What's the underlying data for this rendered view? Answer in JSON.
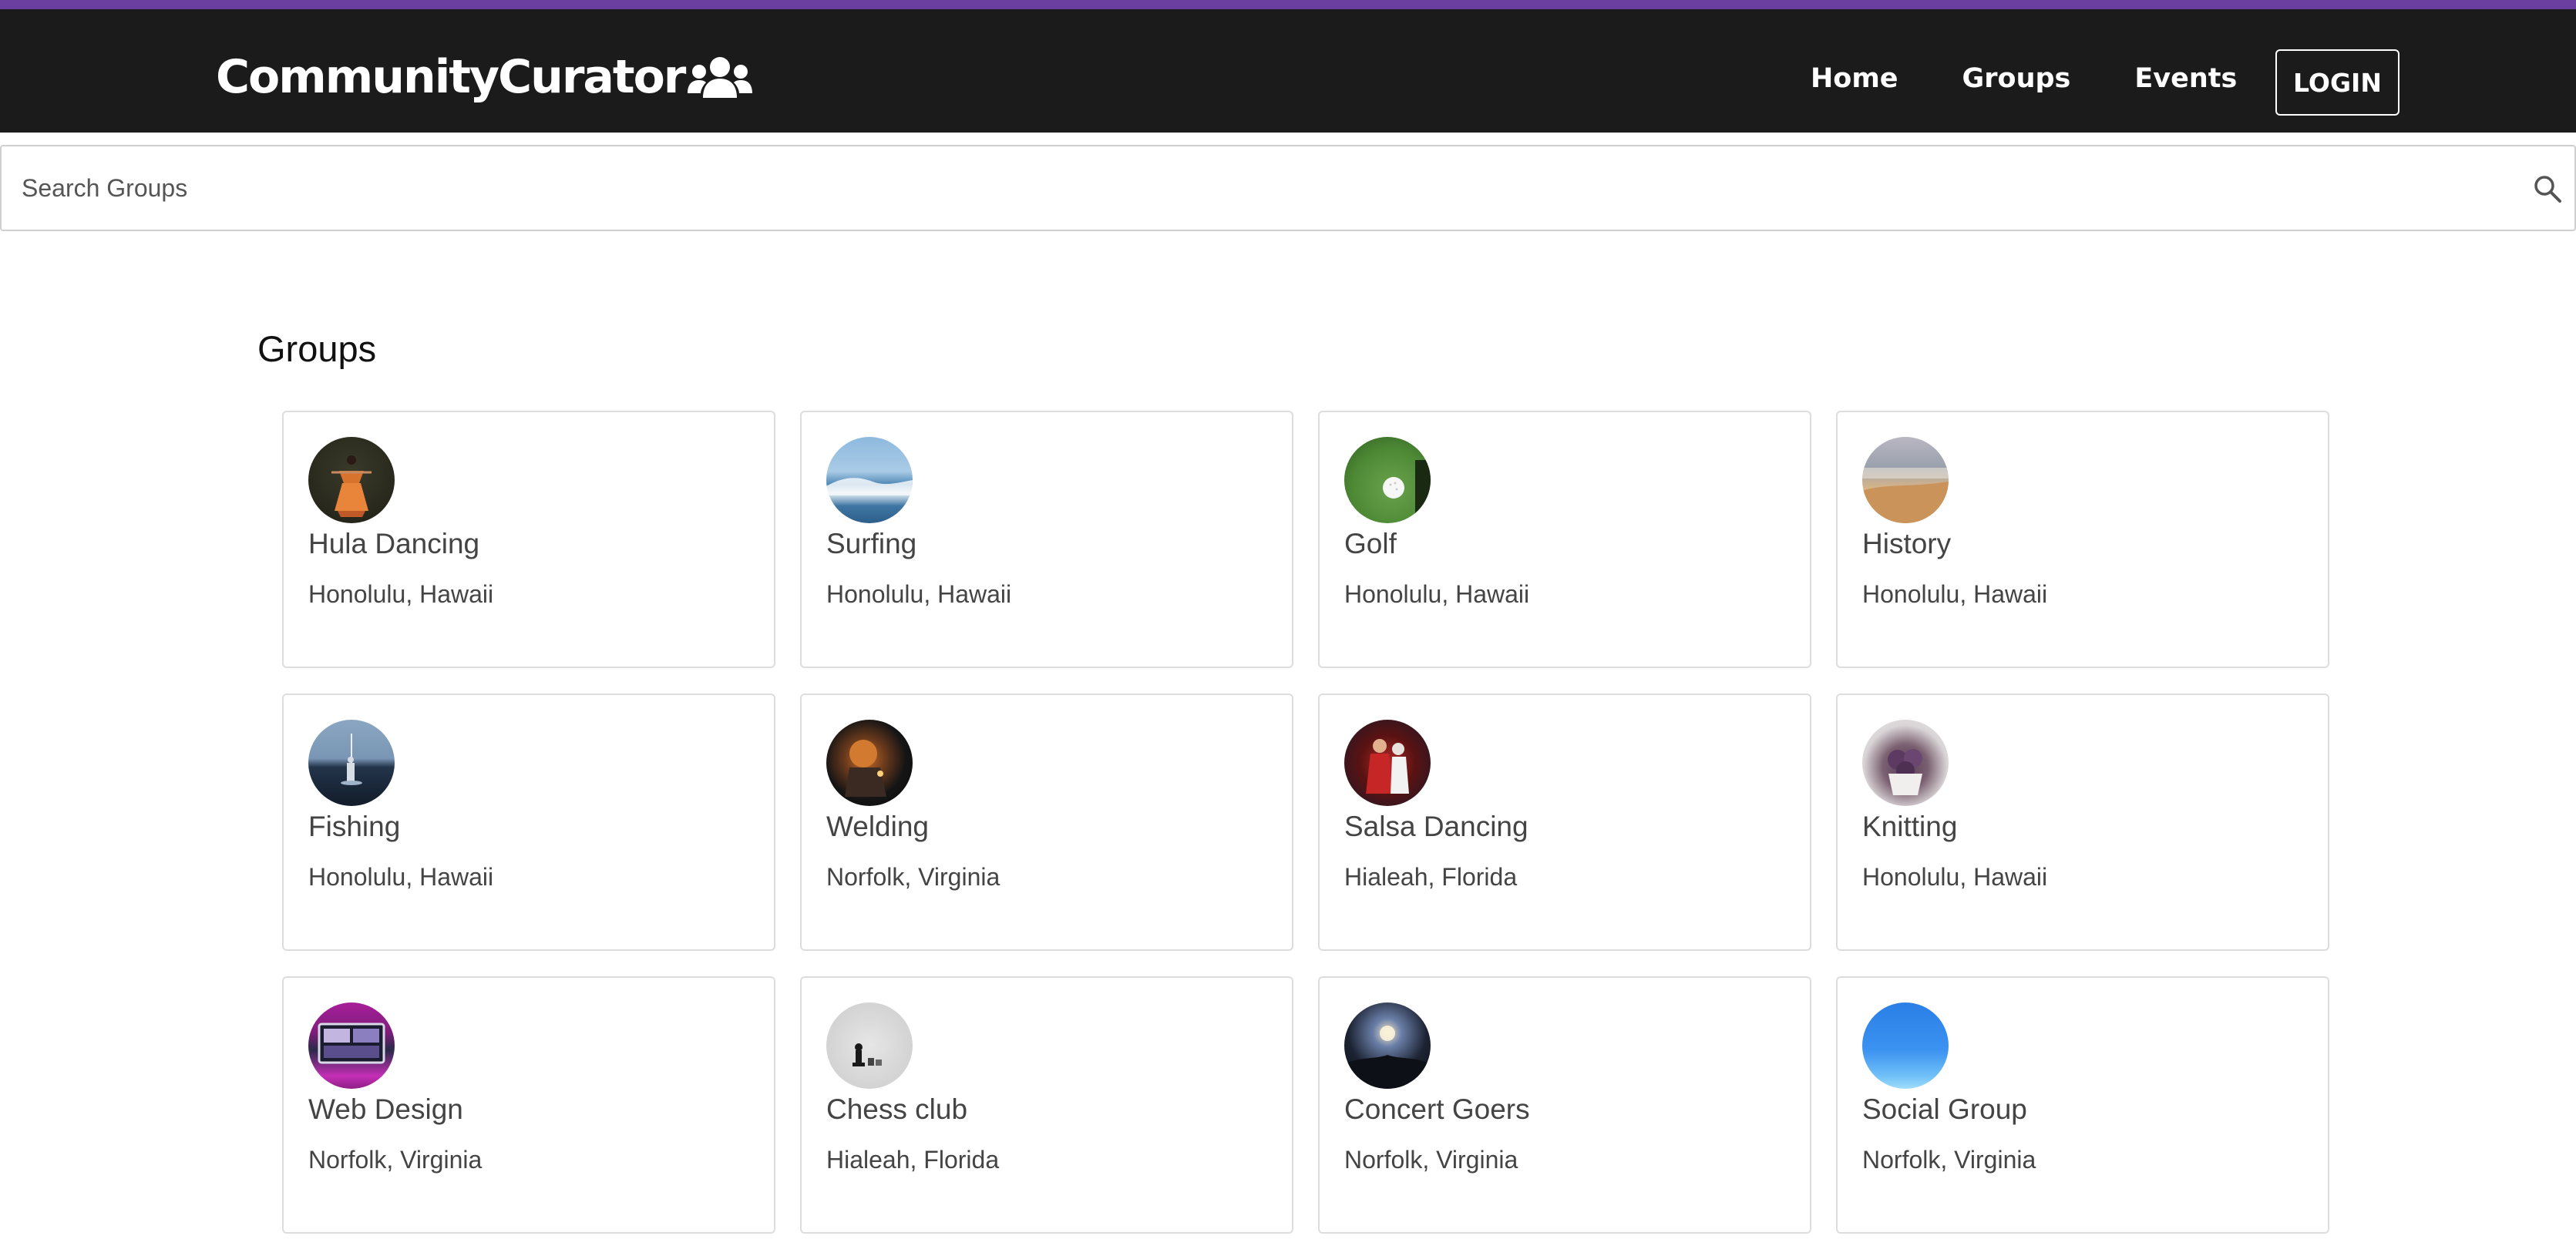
{
  "nav": {
    "brand": "CommunityCurator",
    "brand_icon": "users-icon",
    "links": [
      "Home",
      "Groups",
      "Events"
    ],
    "login_label": "LOGIN"
  },
  "search": {
    "placeholder": "Search Groups",
    "value": "",
    "icon": "search-icon"
  },
  "page": {
    "title": "Groups"
  },
  "groups": [
    {
      "name": "Hula Dancing",
      "location": "Honolulu, Hawaii"
    },
    {
      "name": "Surfing",
      "location": "Honolulu, Hawaii"
    },
    {
      "name": "Golf",
      "location": "Honolulu, Hawaii"
    },
    {
      "name": "History",
      "location": "Honolulu, Hawaii"
    },
    {
      "name": "Fishing",
      "location": "Honolulu, Hawaii"
    },
    {
      "name": "Welding",
      "location": "Norfolk, Virginia"
    },
    {
      "name": "Salsa Dancing",
      "location": "Hialeah, Florida"
    },
    {
      "name": "Knitting",
      "location": "Honolulu, Hawaii"
    },
    {
      "name": "Web Design",
      "location": "Norfolk, Virginia"
    },
    {
      "name": "Chess club",
      "location": "Hialeah, Florida"
    },
    {
      "name": "Concert Goers",
      "location": "Norfolk, Virginia"
    },
    {
      "name": "Social Group",
      "location": "Norfolk, Virginia"
    }
  ],
  "colors": {
    "accent": "#6a3fa0",
    "navbar_bg": "#1c1b1c",
    "card_border": "#dddddd"
  }
}
